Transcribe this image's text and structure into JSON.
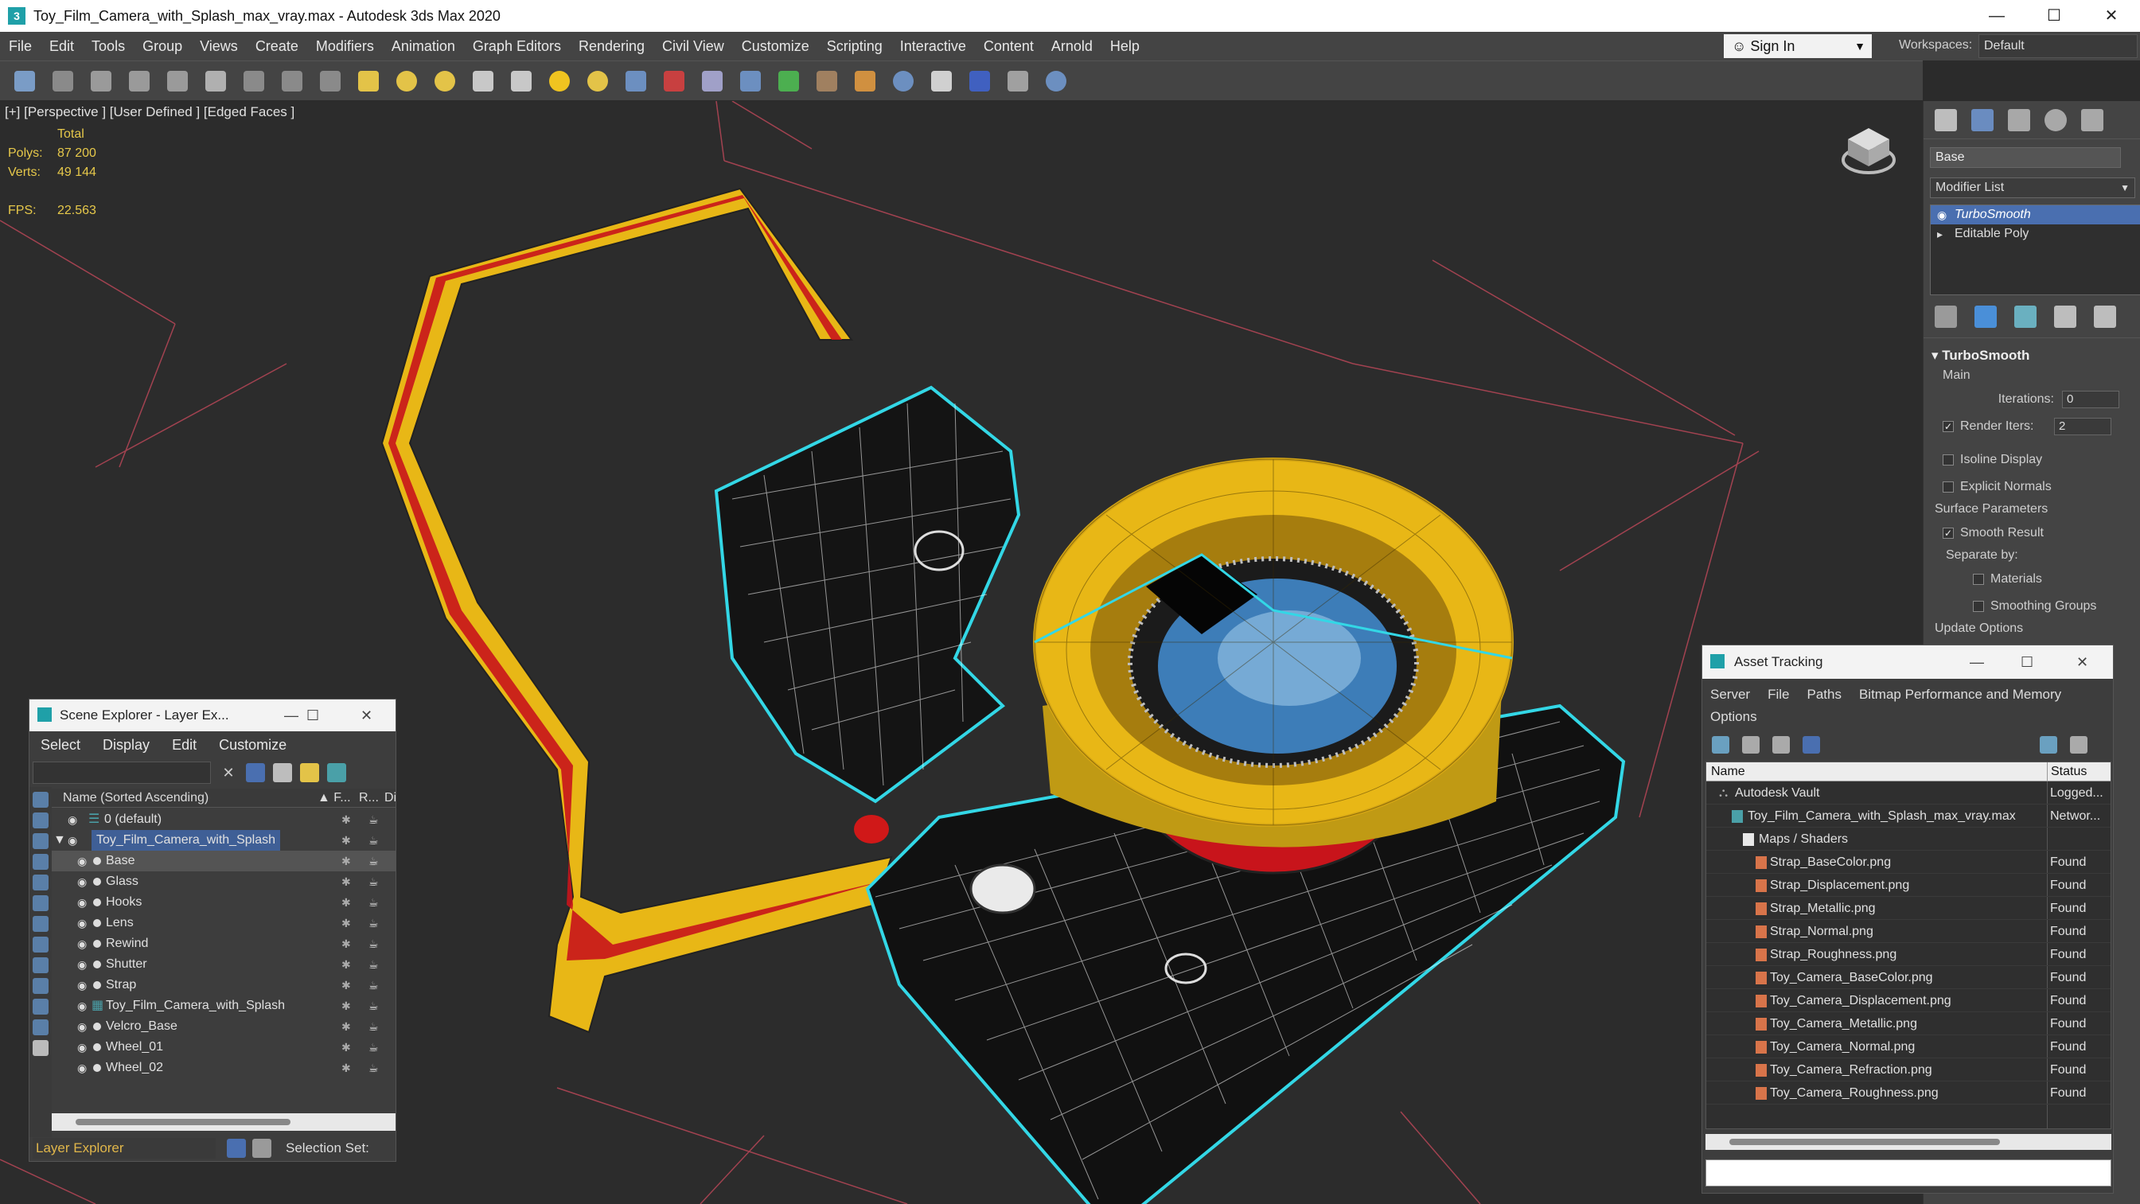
{
  "window": {
    "title": "Toy_Film_Camera_with_Splash_max_vray.max - Autodesk 3ds Max 2020",
    "app_icon": "3",
    "controls": [
      "—",
      "☐",
      "✕"
    ]
  },
  "menu": [
    "File",
    "Edit",
    "Tools",
    "Group",
    "Views",
    "Create",
    "Modifiers",
    "Animation",
    "Graph Editors",
    "Rendering",
    "Civil View",
    "Customize",
    "Scripting",
    "Interactive",
    "Content",
    "Arnold",
    "Help"
  ],
  "signin": {
    "label": "Sign In"
  },
  "workspace": {
    "label": "Workspaces:",
    "value": "Default"
  },
  "viewport": {
    "label": "[+] [Perspective ] [User Defined ] [Edged Faces ]",
    "stats": {
      "total_label": "Total",
      "polys_label": "Polys:",
      "polys": "87 200",
      "verts_label": "Verts:",
      "verts": "49 144",
      "fps_label": "FPS:",
      "fps": "22.563"
    }
  },
  "command_panel": {
    "object_name": "Base",
    "modifier_list": "Modifier List",
    "stack": [
      {
        "label": "TurboSmooth",
        "selected": true
      },
      {
        "label": "Editable Poly",
        "selected": false
      }
    ],
    "rollout": {
      "title": "TurboSmooth",
      "main_label": "Main",
      "iterations_label": "Iterations:",
      "iterations": "0",
      "render_iters_label": "Render Iters:",
      "render_iters": "2",
      "isoline": "Isoline Display",
      "explicit_normals": "Explicit Normals",
      "surface_params": "Surface Parameters",
      "smooth_result": "Smooth Result",
      "separate_by": "Separate by:",
      "materials": "Materials",
      "smoothing_groups": "Smoothing Groups",
      "update_options": "Update Options"
    }
  },
  "scene_explorer": {
    "title": "Scene Explorer - Layer Ex...",
    "menu": [
      "Select",
      "Display",
      "Edit",
      "Customize"
    ],
    "columns": {
      "name": "Name (Sorted Ascending)",
      "frozen": "▲ F...",
      "render": "R...",
      "display": "Displ"
    },
    "rows": [
      {
        "name": "0 (default)",
        "indent": 0,
        "selected": false
      },
      {
        "name": "Toy_Film_Camera_with_Splash",
        "indent": 0,
        "selected": false,
        "highlight": true
      },
      {
        "name": "Base",
        "indent": 1,
        "selected": true
      },
      {
        "name": "Glass",
        "indent": 1,
        "selected": false
      },
      {
        "name": "Hooks",
        "indent": 1,
        "selected": false
      },
      {
        "name": "Lens",
        "indent": 1,
        "selected": false
      },
      {
        "name": "Rewind",
        "indent": 1,
        "selected": false
      },
      {
        "name": "Shutter",
        "indent": 1,
        "selected": false
      },
      {
        "name": "Strap",
        "indent": 1,
        "selected": false
      },
      {
        "name": "Toy_Film_Camera_with_Splash",
        "indent": 1,
        "selected": false
      },
      {
        "name": "Velcro_Base",
        "indent": 1,
        "selected": false
      },
      {
        "name": "Wheel_01",
        "indent": 1,
        "selected": false
      },
      {
        "name": "Wheel_02",
        "indent": 1,
        "selected": false
      }
    ],
    "bottom_dropdown": "Layer Explorer",
    "selection_set_label": "Selection Set:"
  },
  "asset_tracking": {
    "title": "Asset Tracking",
    "menu": [
      "Server",
      "File",
      "Paths",
      "Bitmap Performance and Memory",
      "Options"
    ],
    "columns": {
      "name": "Name",
      "status": "Status"
    },
    "rows": [
      {
        "name": "Autodesk Vault",
        "status": "Logged...",
        "level": 0
      },
      {
        "name": "Toy_Film_Camera_with_Splash_max_vray.max",
        "status": "Networ...",
        "level": 1
      },
      {
        "name": "Maps / Shaders",
        "status": "",
        "level": 2
      },
      {
        "name": "Strap_BaseColor.png",
        "status": "Found",
        "level": 3
      },
      {
        "name": "Strap_Displacement.png",
        "status": "Found",
        "level": 3
      },
      {
        "name": "Strap_Metallic.png",
        "status": "Found",
        "level": 3
      },
      {
        "name": "Strap_Normal.png",
        "status": "Found",
        "level": 3
      },
      {
        "name": "Strap_Roughness.png",
        "status": "Found",
        "level": 3
      },
      {
        "name": "Toy_Camera_BaseColor.png",
        "status": "Found",
        "level": 3
      },
      {
        "name": "Toy_Camera_Displacement.png",
        "status": "Found",
        "level": 3
      },
      {
        "name": "Toy_Camera_Metallic.png",
        "status": "Found",
        "level": 3
      },
      {
        "name": "Toy_Camera_Normal.png",
        "status": "Found",
        "level": 3
      },
      {
        "name": "Toy_Camera_Refraction.png",
        "status": "Found",
        "level": 3
      },
      {
        "name": "Toy_Camera_Roughness.png",
        "status": "Found",
        "level": 3
      }
    ]
  },
  "colors": {
    "selection_blue": "#4a6fb0",
    "wire_cyan": "#33d7e6",
    "lens_gold": "#e8b716",
    "strap_red": "#c8141b",
    "stats_yellow": "#e6c84a"
  }
}
